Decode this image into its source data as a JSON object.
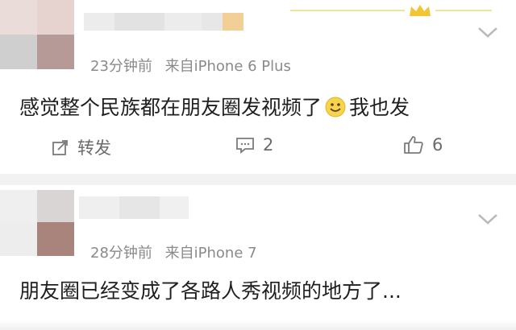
{
  "comments": [
    {
      "time": "23分钟前",
      "device": "来自iPhone 6 Plus",
      "text_before_emoji": "感觉整个民族都在朋友圈发视频了",
      "emoji": "smile-emoji",
      "text_after_emoji": "我也发",
      "actions": {
        "repost_label": "转发",
        "comment_count": "2",
        "like_count": "6"
      }
    },
    {
      "time": "28分钟前",
      "device": "来自iPhone 7",
      "text": "朋友圈已经变成了各路人秀视频的地方了..."
    }
  ],
  "icons": [
    "chevron-down-icon",
    "repost-icon",
    "comment-icon",
    "like-icon",
    "crown-icon",
    "smile-emoji"
  ],
  "colors": {
    "meta_text": "#8a8a8a",
    "body_text": "#1f1f1f",
    "action_text": "#6b6b6b",
    "separator": "#f2f2f2",
    "emoji_yellow": "#f7d54a"
  }
}
